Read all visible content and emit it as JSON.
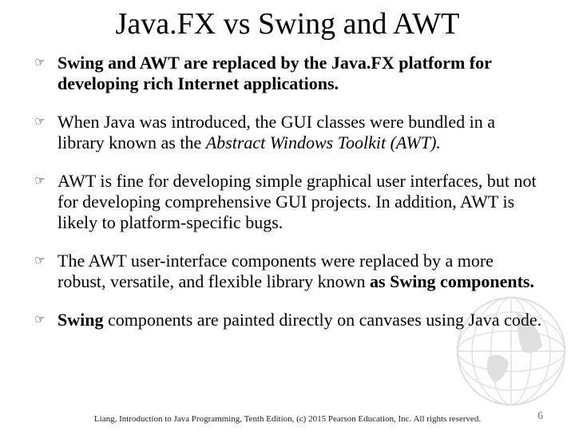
{
  "title": "Java.FX vs Swing and AWT",
  "bullets": [
    {
      "segments": [
        {
          "text": "Swing and AWT are replaced by the Java.FX platform for developing rich Internet applications.",
          "bold": true
        }
      ]
    },
    {
      "segments": [
        {
          "text": "When Java was introduced, the GUI classes were bundled in a library known as the "
        },
        {
          "text": "Abstract Windows Toolkit (AWT).",
          "italic": true
        }
      ]
    },
    {
      "segments": [
        {
          "text": "AWT is fine for developing simple graphical user interfaces, but not for developing comprehensive GUI projects. In addition, AWT is likely to platform-specific bugs."
        }
      ]
    },
    {
      "segments": [
        {
          "text": "The AWT user-interface components were replaced by a more robust, versatile, and flexible library known "
        },
        {
          "text": "as Swing components.",
          "bold": true
        }
      ]
    },
    {
      "segments": [
        {
          "text": "Swing",
          "bold": true
        },
        {
          "text": " components are painted directly on canvases using Java code."
        }
      ]
    }
  ],
  "footer": "Liang, Introduction to Java Programming, Tenth Edition, (c) 2015 Pearson Education, Inc. All rights reserved.",
  "page_number": "6"
}
